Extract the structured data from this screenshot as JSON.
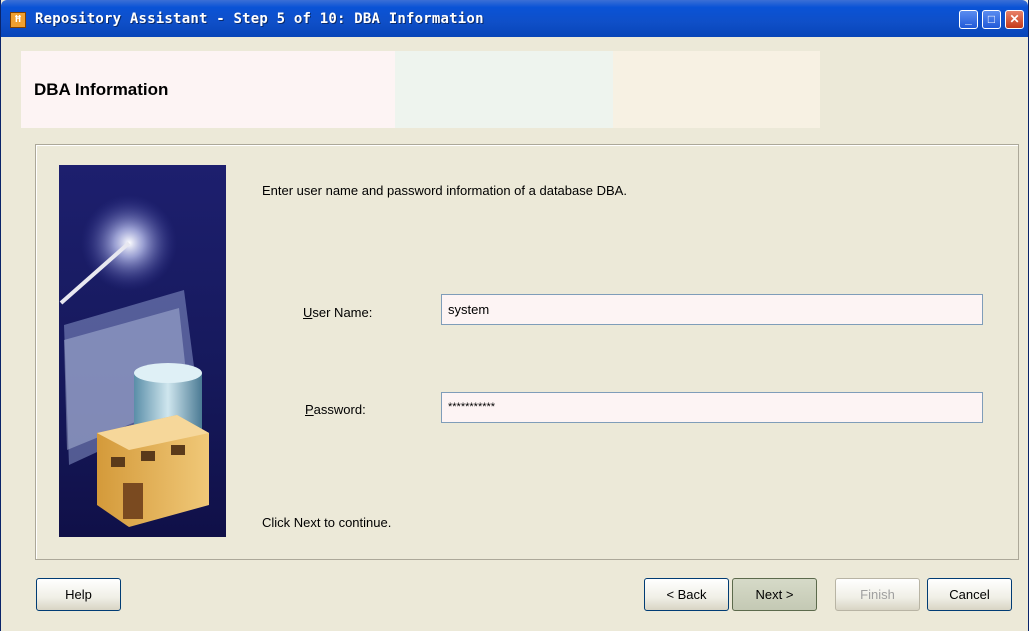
{
  "window": {
    "title": "Repository Assistant - Step 5 of 10: DBA Information",
    "icon": "app-icon"
  },
  "header": {
    "title": "DBA Information"
  },
  "body": {
    "instruction": "Enter user name and password information of a database DBA.",
    "footer_note": "Click Next to continue."
  },
  "form": {
    "username": {
      "label": "User Name:",
      "mnemonic": "U",
      "value": "system"
    },
    "password": {
      "label": "Password:",
      "mnemonic": "P",
      "value": "***********"
    }
  },
  "buttons": {
    "help": "Help",
    "back": "< Back",
    "next": "Next >",
    "finish": "Finish",
    "cancel": "Cancel"
  },
  "colors": {
    "titlebar": "#0a53d6",
    "dialog_bg": "#ece9d8",
    "field_bg": "#fdf4f4",
    "art_bg": "#1d1f6e"
  }
}
